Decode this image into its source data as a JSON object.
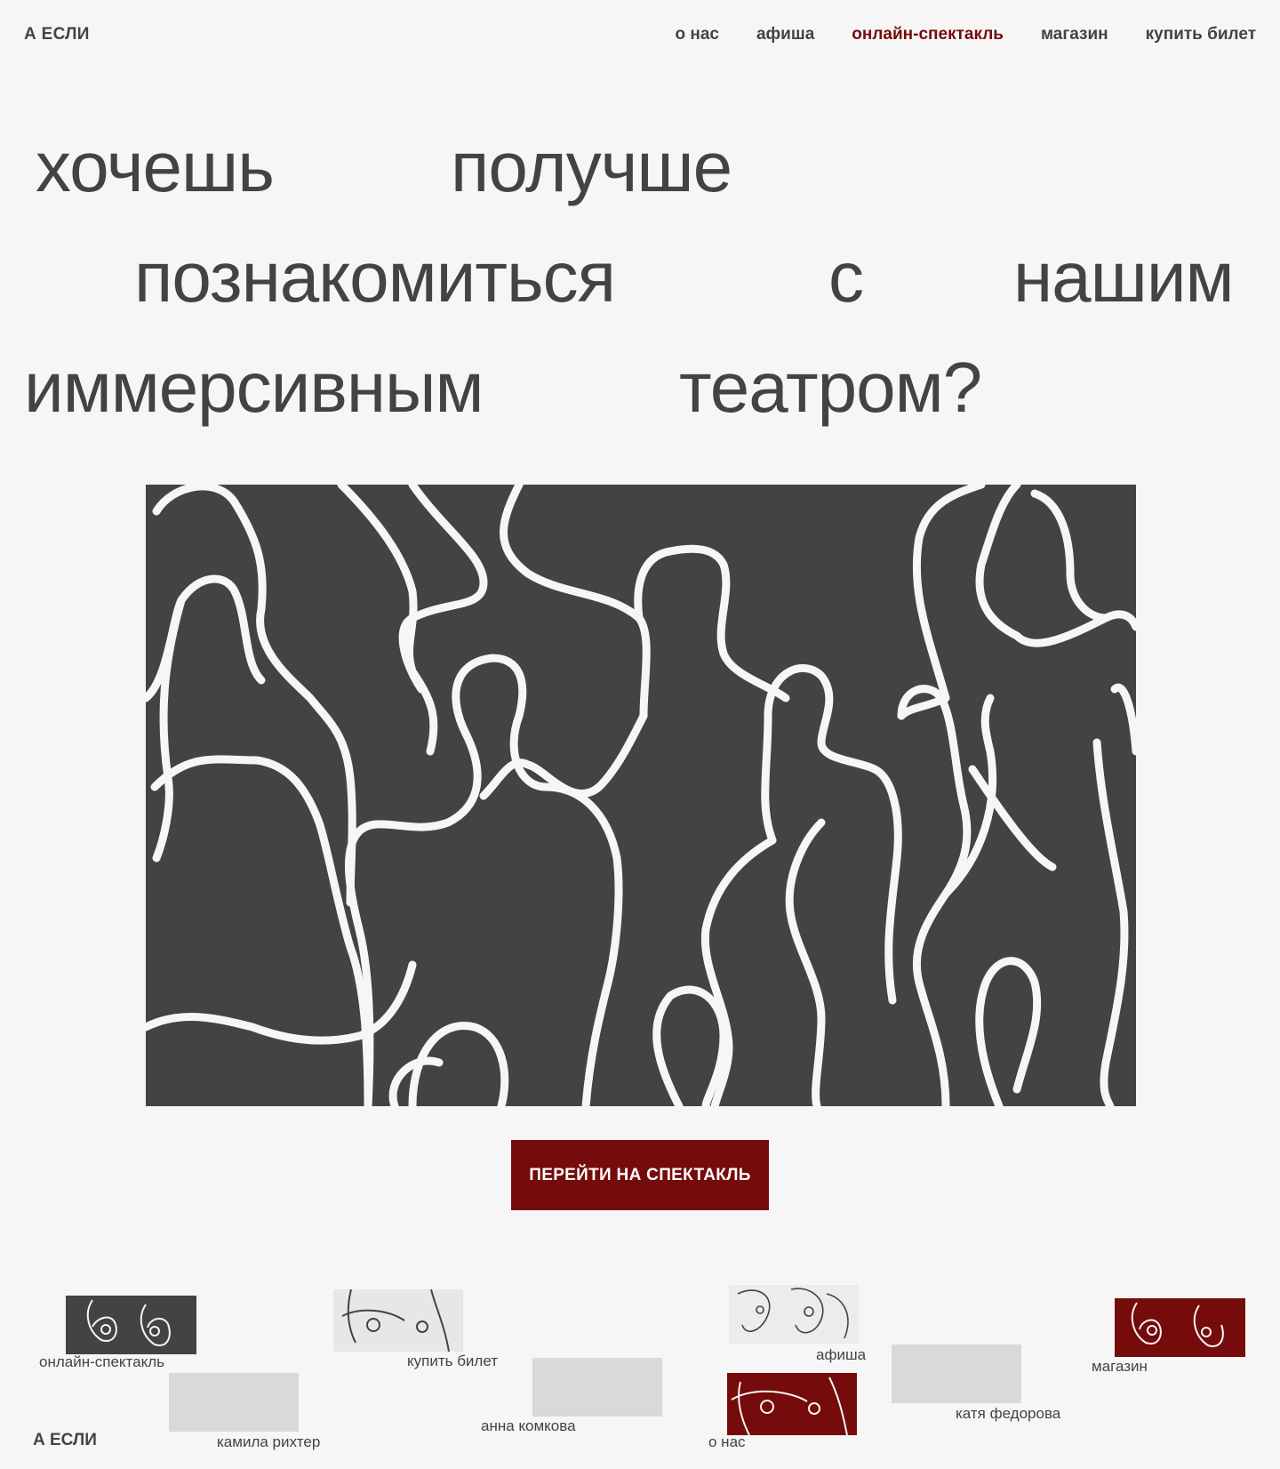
{
  "header": {
    "logo": "А ЕСЛИ",
    "nav": [
      {
        "label": "о нас"
      },
      {
        "label": "афиша"
      },
      {
        "label": "онлайн-спектакль"
      },
      {
        "label": "магазин"
      },
      {
        "label": "купить билет"
      }
    ],
    "active_nav": "онлайн-спектакль"
  },
  "headline": {
    "words": [
      "хочешь",
      "получше",
      "познакомиться",
      "с",
      "нашим",
      "иммерсивным",
      "театром?"
    ]
  },
  "hero_image": {
    "description_icon": "figures-line-art"
  },
  "cta": {
    "label": "ПЕРЕЙТИ НА СПЕКТАКЛЬ"
  },
  "footer": {
    "links": [
      {
        "label": "онлайн-спектакль"
      },
      {
        "label": "купить билет"
      },
      {
        "label": "афиша"
      },
      {
        "label": "магазин"
      },
      {
        "label": "камила рихтер"
      },
      {
        "label": "анна комкова"
      },
      {
        "label": "о нас"
      },
      {
        "label": "катя федорова"
      }
    ],
    "logo": "А ЕСЛИ"
  },
  "colors": {
    "background": "#f6f6f6",
    "text": "#454243",
    "accent": "#750b0b",
    "placeholder": "#d9d9d9"
  }
}
